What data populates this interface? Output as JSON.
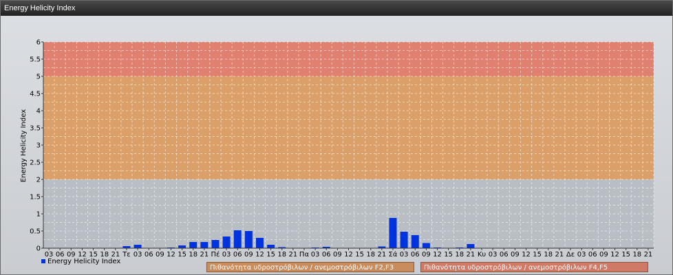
{
  "window": {
    "title": "Energy Helicity Index"
  },
  "legend": {
    "series_label": "Energy Helicity Index",
    "zone_f2f3": "Πιθανότητα υδροστρόβιλων / ανεμοστρόβιλων F2,F3",
    "zone_f4f5": "Πιθανότητα υδροστρόβιλων / ανεμοστρόβιλων F4,F5"
  },
  "colors": {
    "bar": "#0033dd",
    "zone_low": "#b8bec4",
    "zone_mid": "#dba06a",
    "zone_high": "#e08070",
    "legend_mid_bg": "#c98c5c",
    "legend_high_bg": "#cf7a66"
  },
  "chart_data": {
    "type": "bar",
    "title": "",
    "ylabel": "Energy Helicity Index",
    "xlabel": "",
    "ylim": [
      0,
      6
    ],
    "yticks": [
      "0",
      "0.5",
      "1",
      "1.5",
      "2",
      "2.5",
      "3",
      "3.5",
      "4",
      "4.5",
      "5",
      "5.5",
      "6"
    ],
    "grid": true,
    "legend_position": "bottom-left",
    "bands": [
      {
        "from": 0,
        "to": 2,
        "color": "#b8bec4"
      },
      {
        "from": 2,
        "to": 5,
        "color": "#dba06a"
      },
      {
        "from": 5,
        "to": 6,
        "color": "#e08070"
      }
    ],
    "categories": [
      "03",
      "06",
      "09",
      "12",
      "15",
      "18",
      "21",
      "Τε",
      "03",
      "06",
      "09",
      "12",
      "15",
      "18",
      "21",
      "Πέ",
      "03",
      "06",
      "09",
      "12",
      "15",
      "18",
      "21",
      "Πα",
      "03",
      "06",
      "09",
      "12",
      "15",
      "18",
      "21",
      "Σά",
      "03",
      "06",
      "09",
      "12",
      "15",
      "18",
      "21",
      "Κυ",
      "03",
      "06",
      "09",
      "12",
      "15",
      "18",
      "21",
      "Δε",
      "03",
      "06",
      "09",
      "12",
      "15",
      "18",
      "21"
    ],
    "series": [
      {
        "name": "Energy Helicity Index",
        "values": [
          0.01,
          0.01,
          0.01,
          0.01,
          0.01,
          0.01,
          0.01,
          0.06,
          0.1,
          0.01,
          0.01,
          0.02,
          0.08,
          0.18,
          0.18,
          0.24,
          0.34,
          0.52,
          0.5,
          0.3,
          0.1,
          0.03,
          0.01,
          0.01,
          0.02,
          0.04,
          0.01,
          0.01,
          0.01,
          0.01,
          0.05,
          0.88,
          0.48,
          0.38,
          0.15,
          0.02,
          0.01,
          0.02,
          0.12,
          0.01,
          0.01,
          0.01,
          0.01,
          0.01,
          0.01,
          0.01,
          0.01,
          0.01,
          0.01,
          0.01,
          0.01,
          0.01,
          0.01,
          0.01,
          0.01
        ]
      }
    ]
  }
}
